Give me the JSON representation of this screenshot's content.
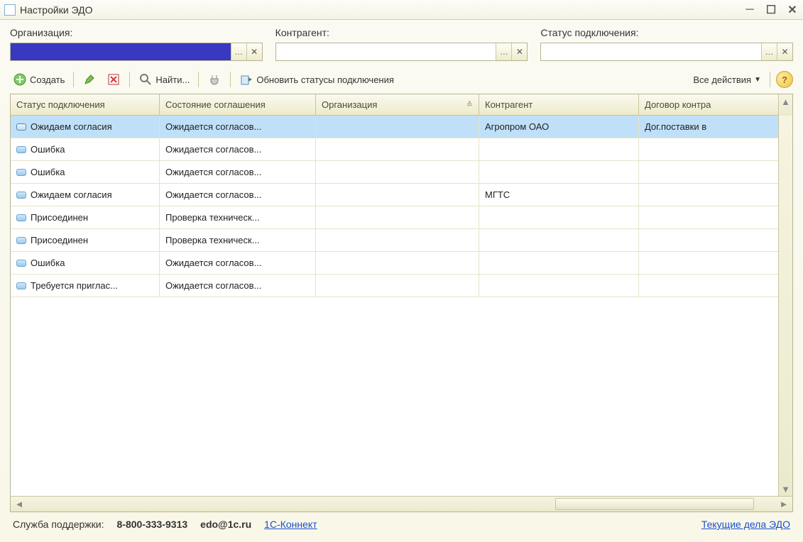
{
  "window": {
    "title": "Настройки ЭДО"
  },
  "filters": {
    "org": {
      "label": "Организация:",
      "value": ""
    },
    "contragent": {
      "label": "Контрагент:",
      "value": ""
    },
    "status": {
      "label": "Статус подключения:",
      "value": ""
    }
  },
  "toolbar": {
    "create": "Создать",
    "find": "Найти...",
    "refresh": "Обновить статусы подключения",
    "all_actions": "Все действия"
  },
  "columns": {
    "c0": "Статус подключения",
    "c1": "Состояние соглашения",
    "c2": "Организация",
    "c3": "Контрагент",
    "c4": "Договор контра"
  },
  "rows": [
    {
      "status": "Ожидаем согласия",
      "state": "Ожидается согласов...",
      "org": "",
      "contragent": "Агропром ОАО",
      "contract": "Дог.поставки в",
      "selected": true
    },
    {
      "status": "Ошибка",
      "state": "Ожидается согласов...",
      "org": "",
      "contragent": "",
      "contract": ""
    },
    {
      "status": "Ошибка",
      "state": "Ожидается согласов...",
      "org": "",
      "contragent": "",
      "contract": ""
    },
    {
      "status": "Ожидаем согласия",
      "state": "Ожидается согласов...",
      "org": "",
      "contragent": "МГТС",
      "contract": ""
    },
    {
      "status": "Присоединен",
      "state": "Проверка техническ...",
      "org": "",
      "contragent": "",
      "contract": ""
    },
    {
      "status": "Присоединен",
      "state": "Проверка техническ...",
      "org": "",
      "contragent": "",
      "contract": ""
    },
    {
      "status": "Ошибка",
      "state": "Ожидается согласов...",
      "org": "",
      "contragent": "",
      "contract": ""
    },
    {
      "status": "Требуется приглас...",
      "state": "Ожидается согласов...",
      "org": "",
      "contragent": "",
      "contract": ""
    }
  ],
  "footer": {
    "support_label": "Служба поддержки:",
    "phone": "8-800-333-9313",
    "email": "edo@1c.ru",
    "connect_link": "1С-Коннект",
    "edo_link": "Текущие дела ЭДО"
  }
}
